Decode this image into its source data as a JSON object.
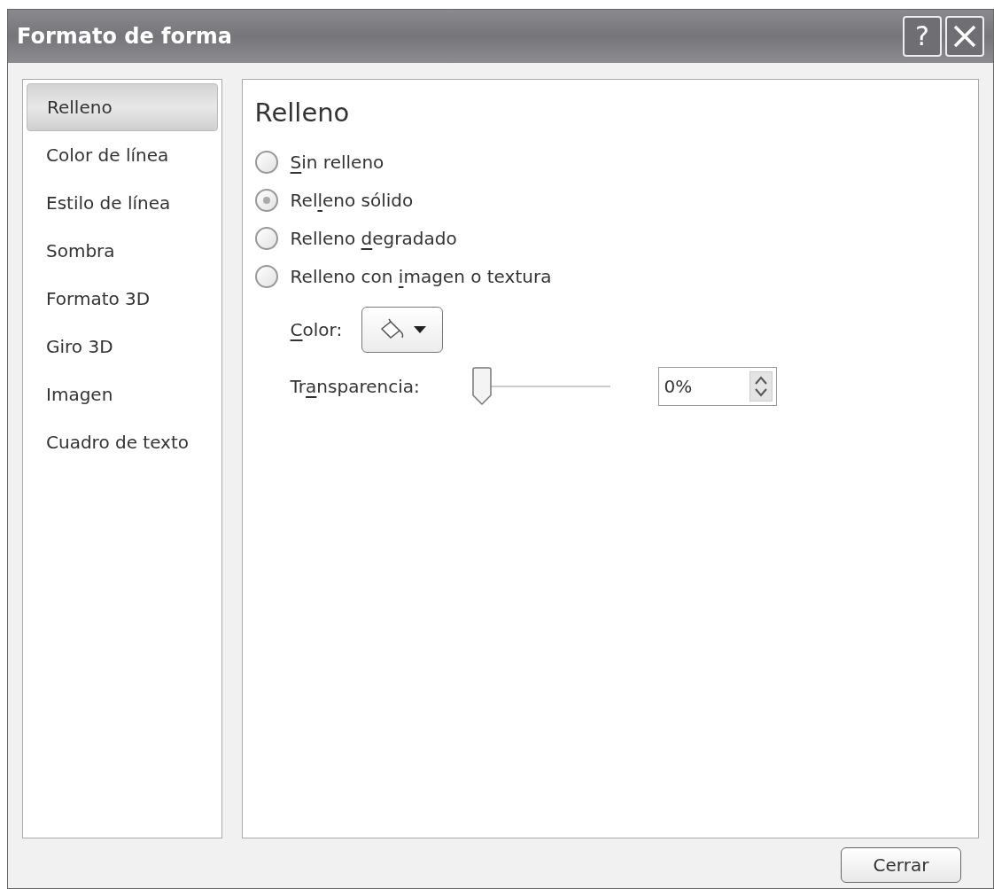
{
  "window": {
    "title": "Formato de forma",
    "help_button": "?"
  },
  "sidebar": {
    "items": [
      {
        "label": "Relleno",
        "selected": true
      },
      {
        "label": "Color de línea",
        "selected": false
      },
      {
        "label": "Estilo de línea",
        "selected": false
      },
      {
        "label": "Sombra",
        "selected": false
      },
      {
        "label": "Formato 3D",
        "selected": false
      },
      {
        "label": "Giro 3D",
        "selected": false
      },
      {
        "label": "Imagen",
        "selected": false
      },
      {
        "label": "Cuadro de texto",
        "selected": false
      }
    ]
  },
  "panel": {
    "heading": "Relleno",
    "options": [
      {
        "label_parts": {
          "key": "S",
          "after": "in relleno"
        },
        "selected": false
      },
      {
        "label_parts": {
          "before": "Rel",
          "key": "l",
          "after": "eno sólido"
        },
        "selected": true
      },
      {
        "label_parts": {
          "before": "Relleno ",
          "key": "d",
          "after": "egradado"
        },
        "selected": false
      },
      {
        "label_parts": {
          "before": "Relleno con ",
          "key": "i",
          "after": "magen o textura"
        },
        "selected": false
      }
    ],
    "color": {
      "label_parts": {
        "key": "C",
        "after": "olor:"
      }
    },
    "transparency": {
      "label_parts": {
        "before": "Tr",
        "key": "a",
        "after": "nsparencia:"
      },
      "level": 0,
      "value": "0%"
    }
  },
  "buttons": [
    "Cerrar"
  ]
}
